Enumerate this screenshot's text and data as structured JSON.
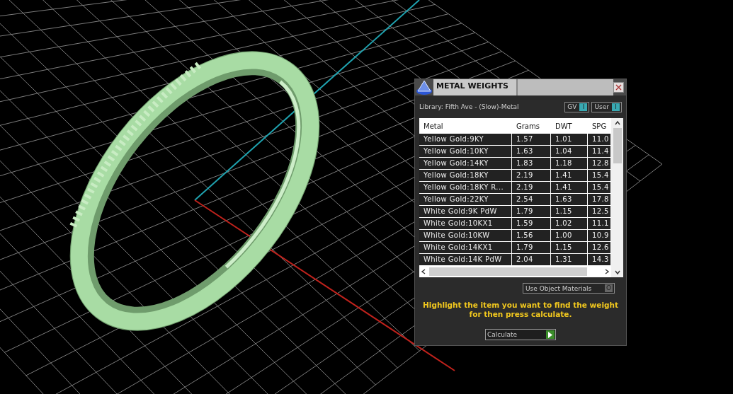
{
  "window": {
    "title": "METAL WEIGHTS"
  },
  "library": "Library: Fifth Ave - (Slow)-Metal",
  "toggles": [
    {
      "label": "GV",
      "glyph": "I",
      "on": true
    },
    {
      "label": "User",
      "glyph": "I",
      "on": true
    }
  ],
  "table": {
    "columns": [
      "Metal",
      "Grams",
      "DWT",
      "SPG"
    ],
    "rows": [
      {
        "cells": [
          "Yellow Gold:9KY",
          "1.57",
          "1.01",
          "11.0"
        ],
        "selected": false
      },
      {
        "cells": [
          "Yellow Gold:10KY",
          "1.63",
          "1.04",
          "11.4"
        ],
        "selected": false
      },
      {
        "cells": [
          "Yellow Gold:14KY",
          "1.83",
          "1.18",
          "12.8"
        ],
        "selected": false
      },
      {
        "cells": [
          "Yellow Gold:18KY",
          "2.19",
          "1.41",
          "15.4"
        ],
        "selected": false
      },
      {
        "cells": [
          "Yellow Gold:18KY R...",
          "2.19",
          "1.41",
          "15.4"
        ],
        "selected": false
      },
      {
        "cells": [
          "Yellow Gold:22KY",
          "2.54",
          "1.63",
          "17.8"
        ],
        "selected": false
      },
      {
        "cells": [
          "White Gold:9K PdW",
          "1.79",
          "1.15",
          "12.5"
        ],
        "selected": false
      },
      {
        "cells": [
          "White Gold:10KX1",
          "1.59",
          "1.02",
          "11.1"
        ],
        "selected": false
      },
      {
        "cells": [
          "White Gold:10KW",
          "1.56",
          "1.00",
          "10.9"
        ],
        "selected": false
      },
      {
        "cells": [
          "White Gold:14KX1",
          "1.79",
          "1.15",
          "12.6"
        ],
        "selected": false
      },
      {
        "cells": [
          "White Gold:14K PdW",
          "2.04",
          "1.31",
          "14.3"
        ],
        "selected": false
      }
    ]
  },
  "use_object_materials": {
    "label": "Use Object Materials",
    "glyph": "O",
    "on": false
  },
  "instruction": "Highlight the item you want to find the weight for then press calculate.",
  "calculate_button": "Calculate"
}
